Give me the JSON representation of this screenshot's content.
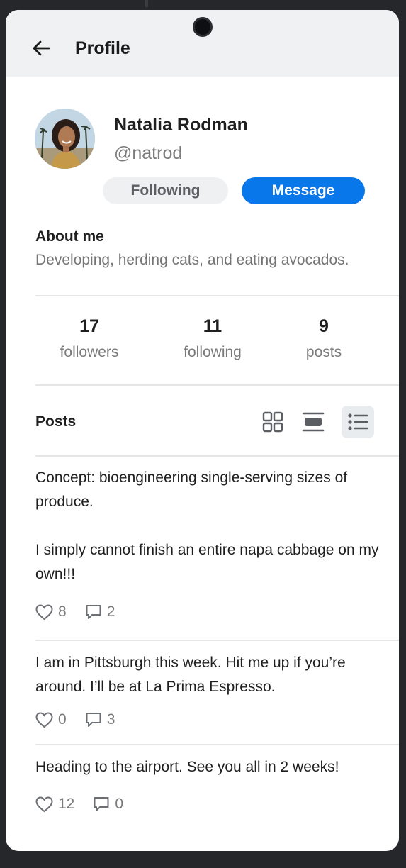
{
  "header": {
    "title": "Profile",
    "back_icon": "arrow-left-icon"
  },
  "profile": {
    "name": "Natalia Rodman",
    "handle": "@natrod",
    "following_label": "Following",
    "message_label": "Message"
  },
  "about": {
    "title": "About me",
    "text": "Developing, herding cats, and eating avocados."
  },
  "stats": [
    {
      "value": "17",
      "label": "followers"
    },
    {
      "value": "11",
      "label": "following"
    },
    {
      "value": "9",
      "label": "posts"
    }
  ],
  "posts_section": {
    "title": "Posts",
    "view_modes": [
      "grid-view-icon",
      "card-view-icon",
      "list-view-icon"
    ],
    "active_view": "list-view-icon"
  },
  "posts": [
    {
      "paragraphs": [
        "Concept: bioengineering single-serving sizes of produce.",
        "I simply cannot finish an entire napa cabbage on my own!!!"
      ],
      "likes": "8",
      "comments": "2"
    },
    {
      "paragraphs": [
        "I am in Pittsburgh this week. Hit me up if you’re around. I’ll be at La Prima Espresso."
      ],
      "likes": "0",
      "comments": "3"
    },
    {
      "paragraphs": [
        "Heading to the airport. See you all in 2 weeks!"
      ],
      "likes": "12",
      "comments": "0"
    }
  ],
  "colors": {
    "accent": "#0877ea",
    "appbar": "#f0f1f2",
    "muted": "#7a7a7a"
  }
}
